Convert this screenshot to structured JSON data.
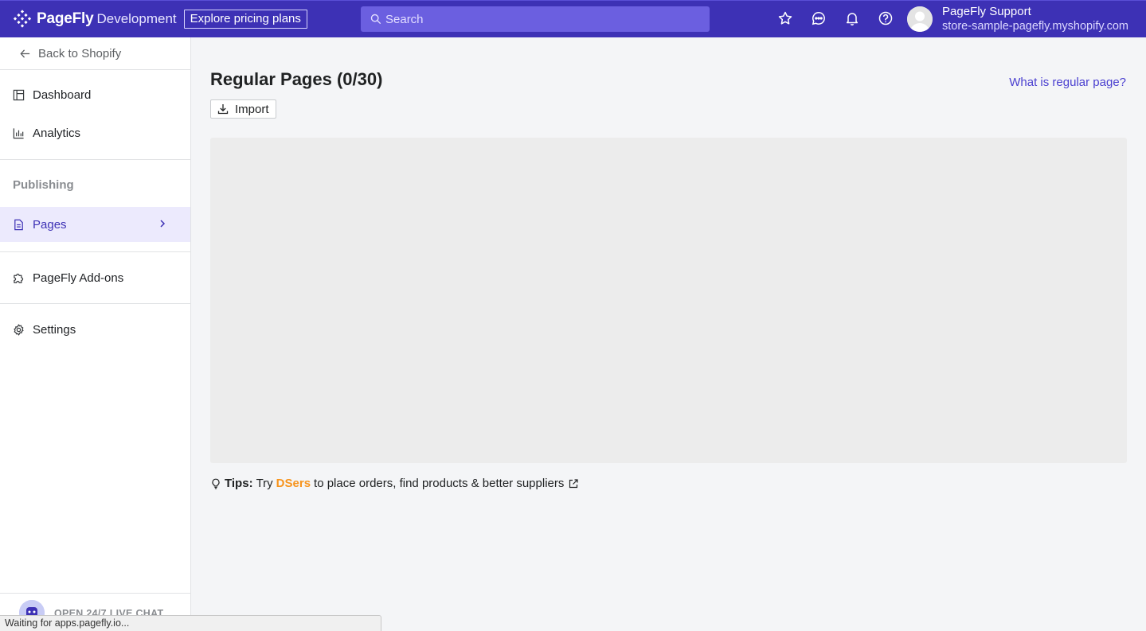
{
  "header": {
    "brand_name": "PageFly",
    "environment": "Development",
    "pricing_button": "Explore pricing plans",
    "search_placeholder": "Search",
    "user": {
      "name": "PageFly Support",
      "store": "store-sample-pagefly.myshopify.com"
    },
    "icons": [
      "star-icon",
      "chat-icon",
      "bell-icon",
      "help-icon"
    ],
    "accent_color": "#3d31b5"
  },
  "sidebar": {
    "back_label": "Back to Shopify",
    "items": [
      {
        "label": "Dashboard",
        "icon": "dashboard-icon"
      },
      {
        "label": "Analytics",
        "icon": "analytics-icon"
      }
    ],
    "section_label": "Publishing",
    "pages_label": "Pages",
    "addons_label": "PageFly Add-ons",
    "settings_label": "Settings",
    "chat_label": "OPEN 24/7 LIVE CHAT"
  },
  "main": {
    "title": "Regular Pages (0/30)",
    "help_link": "What is regular page?",
    "import_label": "Import",
    "tips": {
      "prefix": "Tips:",
      "try": "Try",
      "brand": "DSers",
      "text": "to place orders, find products & better suppliers"
    }
  },
  "status_bar": "Waiting for apps.pagefly.io..."
}
